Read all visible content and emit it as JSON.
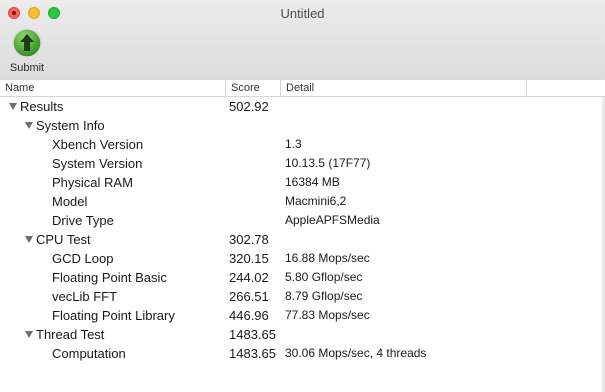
{
  "window": {
    "title": "Untitled"
  },
  "toolbar": {
    "submit_label": "Submit",
    "submit_icon": "up-arrow-circle-icon",
    "submit_color": "#3c9a2a"
  },
  "columns": {
    "name": "Name",
    "score": "Score",
    "detail": "Detail"
  },
  "rows": [
    {
      "name": "Results",
      "score": "502.92",
      "detail": "",
      "level": 0,
      "expanded": true
    },
    {
      "name": "System Info",
      "score": "",
      "detail": "",
      "level": 1,
      "expanded": true
    },
    {
      "name": "Xbench Version",
      "score": "",
      "detail": "1.3",
      "level": 2
    },
    {
      "name": "System Version",
      "score": "",
      "detail": "10.13.5 (17F77)",
      "level": 2
    },
    {
      "name": "Physical RAM",
      "score": "",
      "detail": "16384 MB",
      "level": 2
    },
    {
      "name": "Model",
      "score": "",
      "detail": "Macmini6,2",
      "level": 2
    },
    {
      "name": "Drive Type",
      "score": "",
      "detail": "AppleAPFSMedia",
      "level": 2
    },
    {
      "name": "CPU Test",
      "score": "302.78",
      "detail": "",
      "level": 1,
      "expanded": true
    },
    {
      "name": "GCD Loop",
      "score": "320.15",
      "detail": "16.88 Mops/sec",
      "level": 2
    },
    {
      "name": "Floating Point Basic",
      "score": "244.02",
      "detail": "5.80 Gflop/sec",
      "level": 2
    },
    {
      "name": "vecLib FFT",
      "score": "266.51",
      "detail": "8.79 Gflop/sec",
      "level": 2
    },
    {
      "name": "Floating Point Library",
      "score": "446.96",
      "detail": "77.83 Mops/sec",
      "level": 2
    },
    {
      "name": "Thread Test",
      "score": "1483.65",
      "detail": "",
      "level": 1,
      "expanded": true
    },
    {
      "name": "Computation",
      "score": "1483.65",
      "detail": "30.06 Mops/sec, 4 threads",
      "level": 2
    }
  ]
}
